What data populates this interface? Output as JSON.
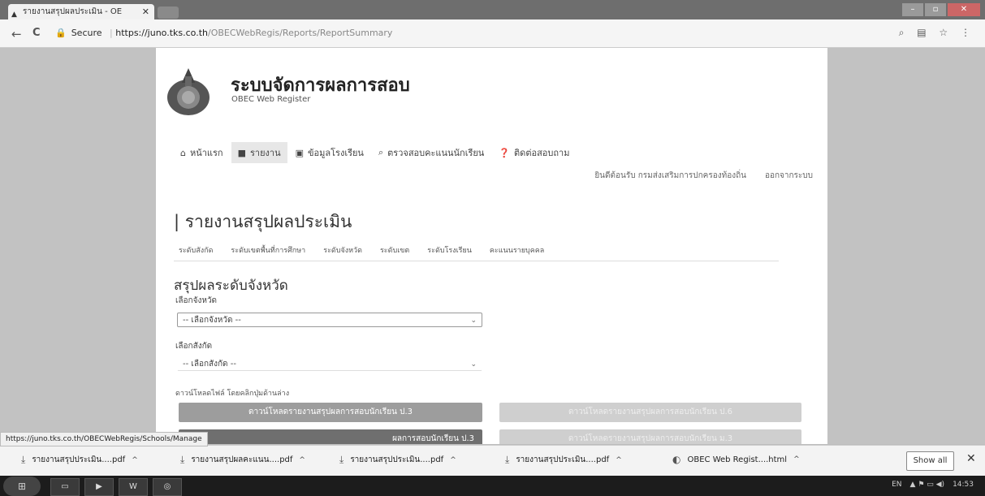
{
  "browser": {
    "tab_title": "รายงานสรุปผลประเมิน - OE",
    "tab_close": "✕",
    "security_label": "Secure",
    "url_host": "https://juno.tks.co.th",
    "url_path": "/OBECWebRegis/Reports/ReportSummary",
    "back": "←",
    "reload": "C",
    "toolbar_icons": "⌕ ▤ ☆ ⋮"
  },
  "site": {
    "title": "ระบบจัดการผลการสอบ",
    "subtitle": "OBEC Web Register"
  },
  "nav": {
    "home": "หน้าแรก",
    "report": "รายงาน",
    "school": "ข้อมูลโรงเรียน",
    "check": "ตรวจสอบคะแนนนักเรียน",
    "contact": "ติดต่อสอบถาม"
  },
  "user": {
    "note": "ยินดีต้อนรับ กรมส่งเสริมการปกครองท้องถิ่น",
    "logout": "ออกจากระบบ"
  },
  "page": {
    "title": "| รายงานสรุปผลประเมิน",
    "tabs": [
      "ระดับสังกัด",
      "ระดับเขตพื้นที่การศึกษา",
      "ระดับจังหวัด",
      "ระดับเขต",
      "ระดับโรงเรียน",
      "คะแนนรายบุคคล"
    ],
    "section_title": "สรุปผลระดับจังหวัด",
    "province_label": "เลือกจังหวัด",
    "province_value": "-- เลือกจังหวัด --",
    "affiliation_label": "เลือกสังกัด",
    "affiliation_value": "-- เลือกสังกัด --",
    "note": "ดาวน์โหลดไฟล์ โดยคลิกปุ่มด้านล่าง",
    "btn1": "ดาวน์โหลดรายงานสรุปผลการสอบนักเรียน ป.3",
    "btn2": "ดาวน์โหลดรายงานสรุปผลการสอบนักเรียน ป.6",
    "btn3_tail": "ผลการสอบนักเรียน ป.3",
    "btn4": "ดาวน์โหลดรายงานสรุปผลการสอบนักเรียน ม.3"
  },
  "status_url": "https://juno.tks.co.th/OBECWebRegis/Schools/Manage",
  "downloads": {
    "items": [
      "รายงานสรุปประเมิน....pdf",
      "รายงานสรุปผลคะแนน....pdf",
      "รายงานสรุปประเมิน....pdf",
      "รายงานสรุปประเมิน....pdf",
      "OBEC Web Regist....html"
    ],
    "show_all": "Show all",
    "close": "✕"
  },
  "taskbar": {
    "lang": "EN",
    "time": "14:53"
  }
}
